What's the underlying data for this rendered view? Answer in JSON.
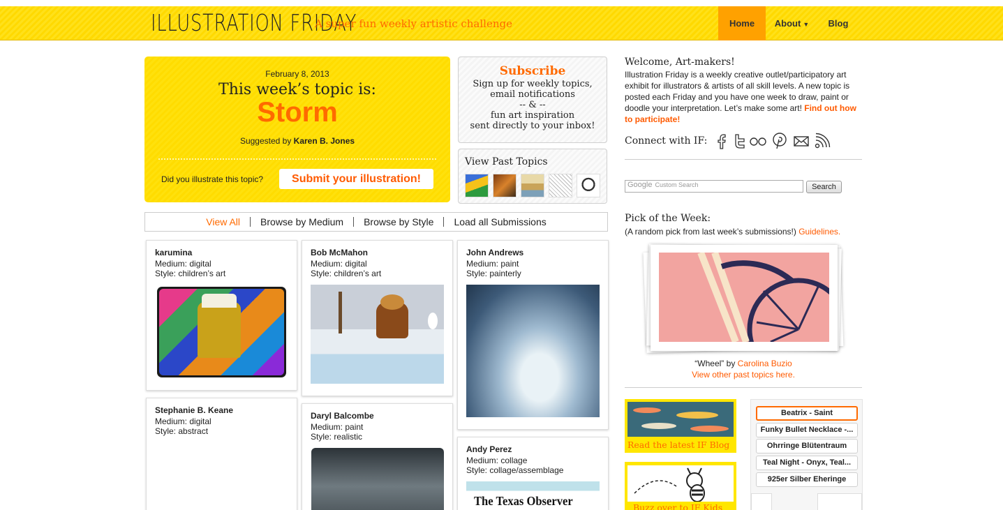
{
  "header": {
    "logo": "ILLUSTRATION FRIDAY",
    "tagline": "A super fun weekly artistic challenge",
    "nav": {
      "home": "Home",
      "about": "About",
      "blog": "Blog"
    }
  },
  "topic": {
    "date": "February 8, 2013",
    "heading": "This week’s topic is:",
    "word": "Storm",
    "suggested_prefix": "Suggested by",
    "suggested_by": "Karen B. Jones",
    "question": "Did you illustrate this topic?",
    "submit_label": "Submit your illustration!"
  },
  "subscribe": {
    "title": "Subscribe",
    "text": "Sign up for weekly topics,\nemail notifications\n-- & --\nfun art inspiration\nsent directly to your inbox!"
  },
  "past_topics": {
    "title": "View Past Topics"
  },
  "filters": [
    "View All",
    "Browse by Medium",
    "Browse by Style",
    "Load all Submissions"
  ],
  "submissions": [
    {
      "name": "karumina",
      "medium": "Medium: digital",
      "style": "Style: children’s art"
    },
    {
      "name": "Bob McMahon",
      "medium": "Medium: digital",
      "style": "Style: children’s art"
    },
    {
      "name": "John Andrews",
      "medium": "Medium: paint",
      "style": "Style: painterly"
    },
    {
      "name": "Stephanie B. Keane",
      "medium": "Medium: digital",
      "style": "Style: abstract"
    },
    {
      "name": "Daryl Balcombe",
      "medium": "Medium: paint",
      "style": "Style: realistic"
    },
    {
      "name": "Andy Perez",
      "medium": "Medium: collage",
      "style": "Style: collage/assemblage",
      "image_text": "The Texas Observer"
    }
  ],
  "sidebar": {
    "welcome_title": "Welcome, Art-makers!",
    "welcome_text": "Illustration Friday is a weekly creative outlet/participatory art exhibit for illustrators & artists of all skill levels. A new topic is posted each Friday and you have one week to draw, paint or doodle your interpretation. Let’s make some art!",
    "welcome_link": "Find out how to participate!",
    "connect_label": "Connect with IF:",
    "social_icons": [
      "facebook-icon",
      "twitter-icon",
      "flickr-icon",
      "pinterest-icon",
      "email-icon",
      "rss-icon"
    ],
    "search": {
      "brand": "Google",
      "placeholder": "Custom Search",
      "button": "Search"
    },
    "pick": {
      "title": "Pick of the Week:",
      "subtitle": "(A random pick from last week’s submissions!)",
      "guidelines": "Guidelines.",
      "caption_title": "“Wheel”",
      "caption_by": "by",
      "artist": "Carolina Buzio",
      "past_link": "View other past topics here."
    },
    "promos": {
      "blog": "Read the latest IF Blog",
      "kids": "Buzz over to IF Kids"
    },
    "shop_items": [
      "Beatrix - Saint",
      "Funky Bullet Necklace -...",
      "Ohrringe Blütentraum",
      "Teal Night  -  Onyx, Teal...",
      "925er Silber Eheringe"
    ]
  },
  "colors": {
    "accent": "#ff6a00",
    "header_yellow": "#ffd900",
    "nav_active": "#ffa100"
  }
}
